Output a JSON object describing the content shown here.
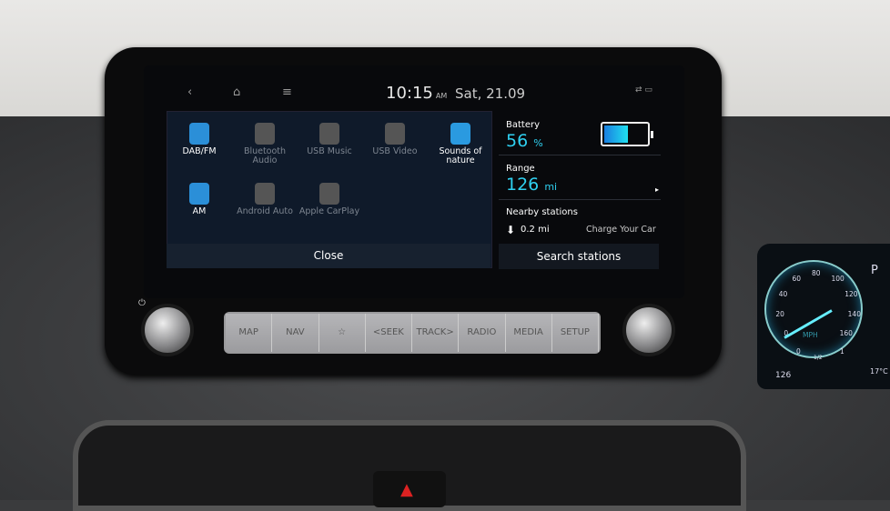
{
  "status": {
    "time": "10:15",
    "ampm": "AM",
    "date": "Sat, 21.09",
    "icons": [
      "back-icon",
      "home-icon",
      "menu-icon"
    ]
  },
  "apps": [
    {
      "label": "DAB/FM",
      "enabled": true,
      "icon": "radio-icon"
    },
    {
      "label": "Bluetooth Audio",
      "enabled": false,
      "icon": "bluetooth-audio-icon"
    },
    {
      "label": "USB Music",
      "enabled": false,
      "icon": "usb-music-icon"
    },
    {
      "label": "USB Video",
      "enabled": false,
      "icon": "usb-video-icon"
    },
    {
      "label": "Sounds of nature",
      "enabled": true,
      "icon": "leaf-icon"
    },
    {
      "label": "AM",
      "enabled": true,
      "icon": "radio-icon"
    },
    {
      "label": "Android Auto",
      "enabled": false,
      "icon": "android-auto-icon"
    },
    {
      "label": "Apple CarPlay",
      "enabled": false,
      "icon": "carplay-icon"
    }
  ],
  "close_label": "Close",
  "ev": {
    "battery_label": "Battery",
    "battery_value": "56",
    "battery_unit": "%",
    "battery_level": 56,
    "range_label": "Range",
    "range_value": "126",
    "range_unit": "mi",
    "nearby_label": "Nearby stations",
    "nearby_distance": "0.2 mi",
    "charge_label": "Charge Your Car",
    "search_label": "Search stations"
  },
  "hard_keys": [
    "MAP",
    "NAV",
    "☆",
    "<SEEK",
    "TRACK>",
    "RADIO",
    "MEDIA",
    "SETUP"
  ],
  "cluster": {
    "speed_ticks": [
      "0",
      "20",
      "40",
      "60",
      "80",
      "100",
      "120",
      "140",
      "160"
    ],
    "unit": "MPH",
    "gear": "P",
    "range": "126",
    "temp": "17°C",
    "fuel_labels": [
      "0",
      "1/2",
      "1"
    ]
  },
  "colors": {
    "accent": "#2fd0f0"
  }
}
